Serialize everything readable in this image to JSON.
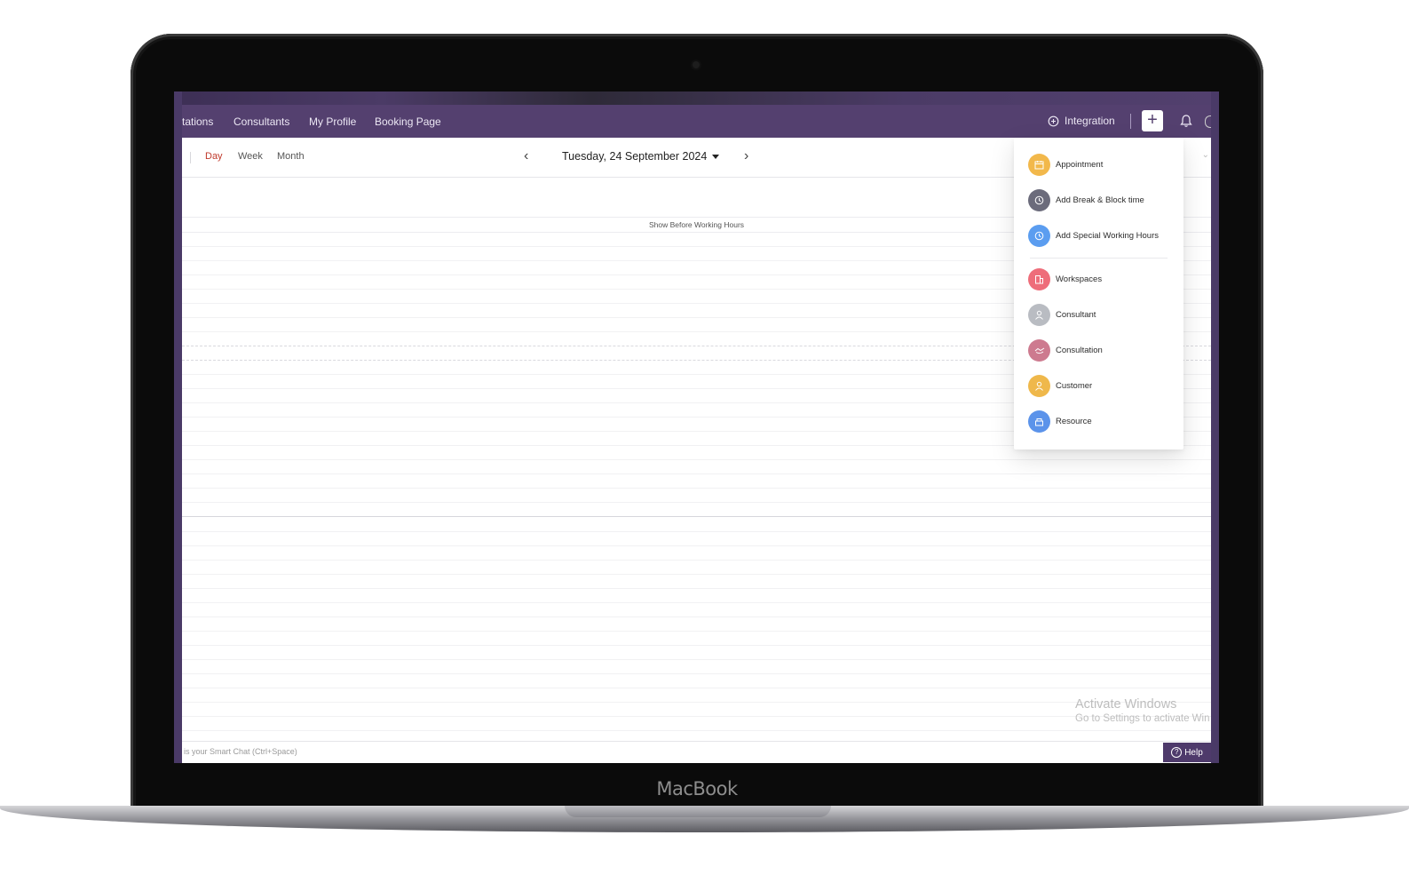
{
  "device": {
    "brand_label": "MacBook"
  },
  "nav": {
    "links": [
      "tations",
      "Consultants",
      "My Profile",
      "Booking Page"
    ],
    "integration_label": "Integration",
    "add_symbol": "+"
  },
  "toolbar": {
    "views": [
      "Day",
      "Week",
      "Month"
    ],
    "active_view": "Day",
    "date": "Tuesday, 24 September 2024",
    "prev_symbol": "‹",
    "next_symbol": "›"
  },
  "calendar": {
    "show_before_label": "Show Before Working Hours"
  },
  "add_menu": {
    "items": [
      {
        "label": "Appointment",
        "icon": "calendar-icon",
        "color": "#f2b84b"
      },
      {
        "label": "Add Break & Block time",
        "icon": "clock-icon",
        "color": "#6b6b7b"
      },
      {
        "label": "Add Special Working Hours",
        "icon": "clock-icon",
        "color": "#5b9df0"
      },
      {
        "label": "Workspaces",
        "icon": "building-icon",
        "color": "#ee6d7a"
      },
      {
        "label": "Consultant",
        "icon": "person-icon",
        "color": "#b9bcc2"
      },
      {
        "label": "Consultation",
        "icon": "handshake-icon",
        "color": "#cd7a8f"
      },
      {
        "label": "Customer",
        "icon": "person-icon",
        "color": "#efb84b"
      },
      {
        "label": "Resource",
        "icon": "box-icon",
        "color": "#5b93ea"
      }
    ]
  },
  "watermark": {
    "title": "Activate Windows",
    "subtitle": "Go to Settings to activate Win"
  },
  "bottombar": {
    "chat_hint": "is your Smart Chat (Ctrl+Space)",
    "help_label": "Help"
  },
  "colors": {
    "nav_bg": "#54406f",
    "active_tab": "#c0392b",
    "help_bg": "#4e3a6b"
  }
}
